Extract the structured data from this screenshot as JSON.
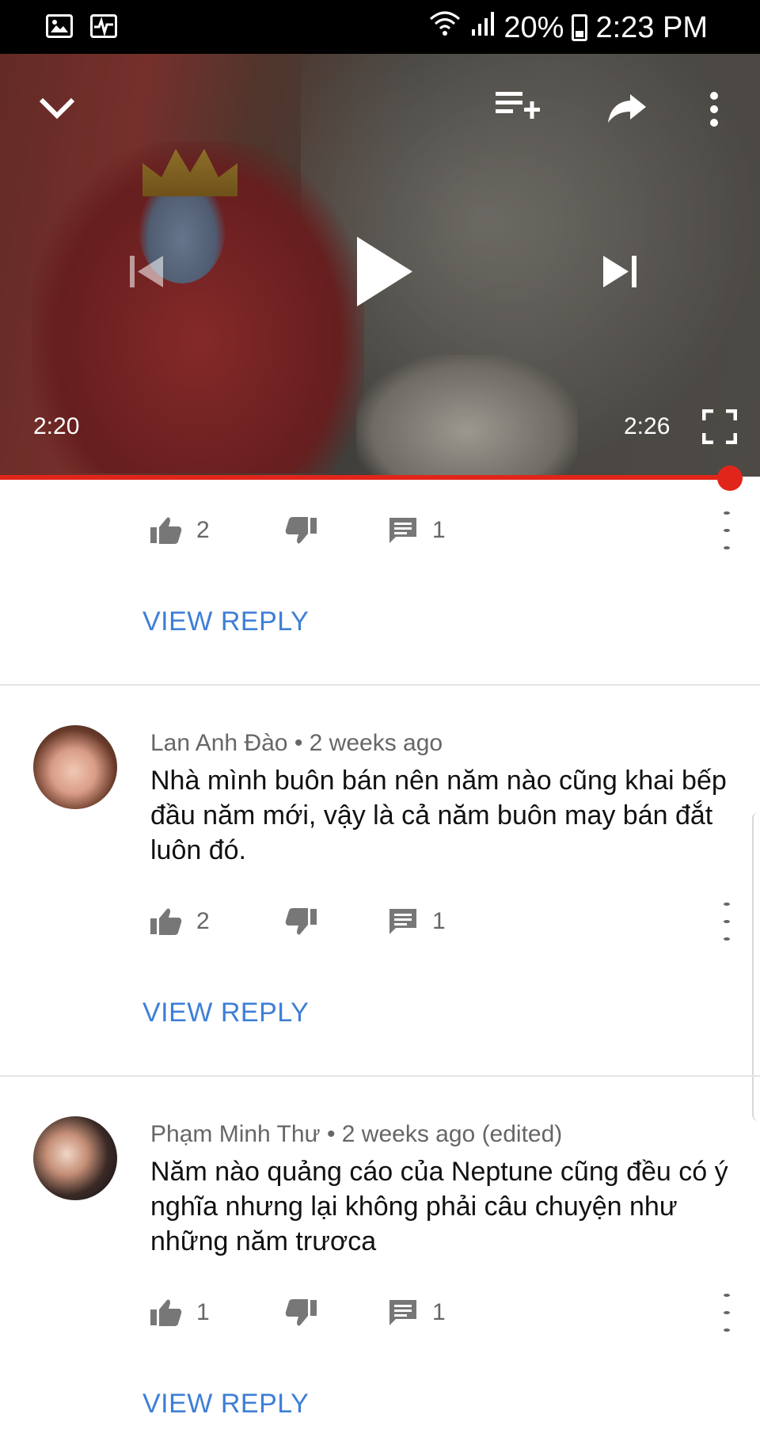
{
  "status_bar": {
    "icons_left": [
      "image-icon",
      "activity-icon"
    ],
    "battery_pct": "20%",
    "time": "2:23 PM"
  },
  "video": {
    "current_time": "2:20",
    "total_time": "2:26",
    "progress_fraction": 0.96
  },
  "comments": [
    {
      "author": "",
      "meta": "",
      "text": "",
      "likes": "2",
      "replies": "1",
      "view_reply": "VIEW REPLY"
    },
    {
      "author": "Lan Anh Đào",
      "meta": "Lan Anh Đào • 2 weeks ago",
      "text": "Nhà mình buôn bán nên năm nào cũng khai bếp đầu năm mới, vậy là cả năm buôn may bán đắt luôn đó.",
      "likes": "2",
      "replies": "1",
      "view_reply": "VIEW REPLY"
    },
    {
      "author": "Phạm Minh Thư",
      "meta": "Phạm Minh Thư • 2 weeks ago (edited)",
      "text": "Năm nào quảng cáo của Neptune cũng đều có ý nghĩa nhưng lại không phải câu chuyện như những năm trươca",
      "likes": "1",
      "replies": "1",
      "view_reply": "VIEW REPLY"
    }
  ],
  "colors": {
    "accent_link": "#3e7fd6",
    "progress": "#e1251b"
  }
}
